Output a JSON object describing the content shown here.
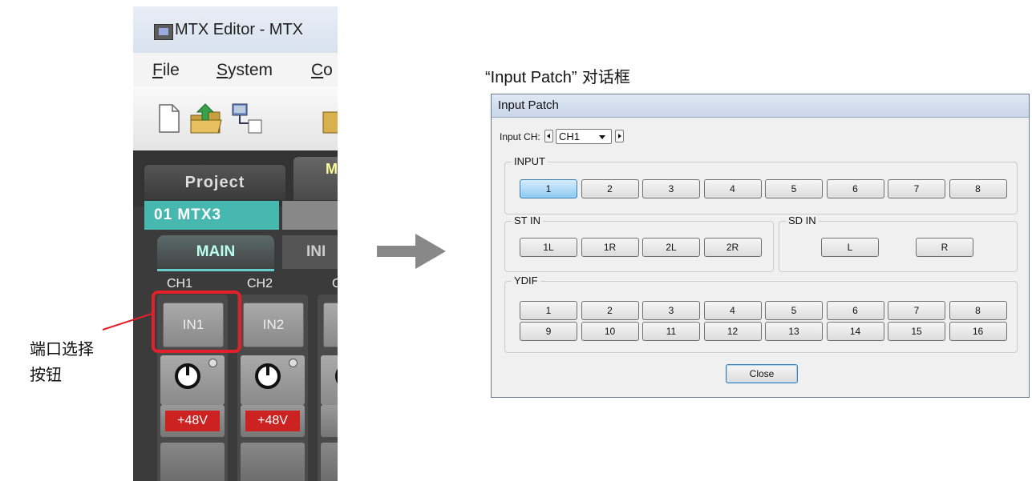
{
  "editor": {
    "title": "MTX Editor - MTX",
    "menus": [
      {
        "mnemonic": "F",
        "rest": "ile"
      },
      {
        "mnemonic": "S",
        "rest": "ystem"
      },
      {
        "mnemonic": "C",
        "rest": "o"
      }
    ],
    "tabs": {
      "project": "Project",
      "partial": "M"
    },
    "device_tab": "01 MTX3",
    "sub_tabs": {
      "main": "MAIN",
      "partial": "INI"
    },
    "channels": [
      {
        "label": "CH1",
        "port": "IN1",
        "phantom": "+48V"
      },
      {
        "label": "CH2",
        "port": "IN2",
        "phantom": "+48V"
      }
    ],
    "highlight_color": "#e3202a"
  },
  "annotation": {
    "line1": "端口选择",
    "line2": "按钮"
  },
  "caption": {
    "quoted": "“Input Patch”",
    "suffix": " 对话框"
  },
  "dialog": {
    "title": "Input Patch",
    "input_ch_label": "Input CH:",
    "input_ch_value": "CH1",
    "groups": {
      "input": {
        "label": "INPUT",
        "buttons": [
          "1",
          "2",
          "3",
          "4",
          "5",
          "6",
          "7",
          "8"
        ],
        "selected": "1"
      },
      "st_in": {
        "label": "ST IN",
        "buttons": [
          "1L",
          "1R",
          "2L",
          "2R"
        ]
      },
      "sd_in": {
        "label": "SD IN",
        "buttons": [
          "L",
          "R"
        ]
      },
      "ydif": {
        "label": "YDIF",
        "buttons": [
          "1",
          "2",
          "3",
          "4",
          "5",
          "6",
          "7",
          "8",
          "9",
          "10",
          "11",
          "12",
          "13",
          "14",
          "15",
          "16"
        ]
      }
    },
    "close_label": "Close",
    "accent": "#8ecaf2"
  }
}
